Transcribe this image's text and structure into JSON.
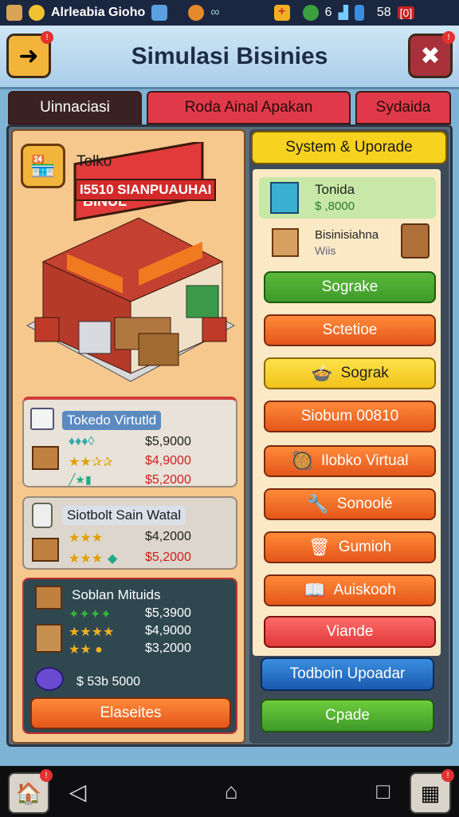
{
  "statusbar": {
    "app_name": "Alrleabia Gioho",
    "signal_text": "6",
    "time": "58",
    "battery_label": "[0]"
  },
  "header": {
    "title": "Simulasi Bisinies"
  },
  "tabs": [
    {
      "label": "Uinnaciasi"
    },
    {
      "label": "Roda Ainal Apakan"
    },
    {
      "label": "Sydaida"
    }
  ],
  "left": {
    "store_label": "Tolko",
    "store_sign": "I5510 SIANPUAUHAI",
    "store_sign_top": "BINUL",
    "cards": [
      {
        "title": "Tokedo Virtutld",
        "prices": [
          "$5,9000",
          "$4,9000",
          "$5,2000"
        ]
      },
      {
        "title": "Siotbolt Sain Watal",
        "prices": [
          "$4,2000",
          "$5,2000"
        ]
      },
      {
        "title": "Soblan Mituids",
        "prices": [
          "$5,3900",
          "$4,9000",
          "$3,2000"
        ],
        "extra": "$ 53b 5000"
      }
    ],
    "bottom_button": "Elaseites"
  },
  "right": {
    "header_label": "System & Uporade",
    "item1": {
      "name": "Tonida",
      "value": "$ ,8000"
    },
    "item2": {
      "name": "Bisinisiahna",
      "sub": "Wiis"
    },
    "buttons": [
      "Sograke",
      "Sctetioe",
      "Sograk",
      "Siobum 00810",
      "Ilobko Virtual",
      "Sonoolé",
      "Gumioh",
      "Auiskooh",
      "Viande"
    ],
    "upgrade_button": "Todboin Upoadar",
    "green_button": "Cpade"
  },
  "colors": {
    "accent": "#e4561a",
    "green": "#3f9a2a",
    "yellow": "#f7d21e",
    "red": "#e03a3a"
  }
}
